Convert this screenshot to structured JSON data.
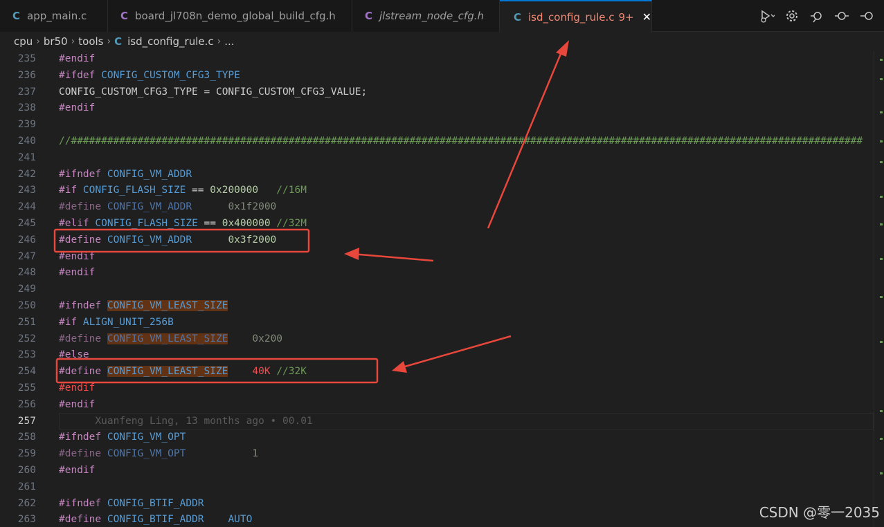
{
  "tabs": [
    {
      "label": "app_main.c",
      "kind": "c",
      "italic": false,
      "active": false
    },
    {
      "label": "board_jl708n_demo_global_build_cfg.h",
      "kind": "c",
      "italic": false,
      "active": false
    },
    {
      "label": "jlstream_node_cfg.h",
      "kind": "c",
      "italic": true,
      "active": false
    },
    {
      "label": "isd_config_rule.c",
      "kind": "c",
      "italic": false,
      "active": true,
      "badge": "9+"
    }
  ],
  "file_icon_glyph": "C",
  "close_glyph": "✕",
  "breadcrumb": [
    "cpu",
    "br50",
    "tools",
    "isd_config_rule.c",
    "..."
  ],
  "toolbar_icons": [
    "run-debug-icon",
    "chevron-down-icon",
    "settings-icon",
    "timeline-icon",
    "git-commit-icon",
    "more-icon"
  ],
  "lines": [
    {
      "n": "235",
      "parts": [
        [
          "k",
          "#endif"
        ]
      ]
    },
    {
      "n": "236",
      "parts": [
        [
          "k",
          "#ifdef "
        ],
        [
          "m",
          "CONFIG_CUSTOM_CFG3_TYPE"
        ]
      ]
    },
    {
      "n": "237",
      "parts": [
        [
          "t",
          "CONFIG_CUSTOM_CFG3_TYPE = CONFIG_CUSTOM_CFG3_VALUE;"
        ]
      ]
    },
    {
      "n": "238",
      "parts": [
        [
          "k",
          "#endif"
        ]
      ]
    },
    {
      "n": "239",
      "parts": []
    },
    {
      "n": "240",
      "parts": [
        [
          "c",
          "//###################################################################################################################################"
        ]
      ]
    },
    {
      "n": "241",
      "parts": []
    },
    {
      "n": "242",
      "parts": [
        [
          "k",
          "#ifndef "
        ],
        [
          "m",
          "CONFIG_VM_ADDR"
        ]
      ]
    },
    {
      "n": "243",
      "parts": [
        [
          "k",
          "#if "
        ],
        [
          "m",
          "CONFIG_FLASH_SIZE"
        ],
        [
          "t",
          " == "
        ],
        [
          "n",
          "0x200000"
        ],
        [
          "t",
          "   "
        ],
        [
          "c",
          "//16M"
        ]
      ]
    },
    {
      "n": "244",
      "parts": [
        [
          "kd",
          "#define "
        ],
        [
          "mi",
          "CONFIG_VM_ADDR"
        ],
        [
          "t",
          "      "
        ],
        [
          "nd",
          "0x1f2000"
        ]
      ]
    },
    {
      "n": "245",
      "parts": [
        [
          "k",
          "#elif "
        ],
        [
          "m",
          "CONFIG_FLASH_SIZE"
        ],
        [
          "t",
          " == "
        ],
        [
          "n",
          "0x400000"
        ],
        [
          "t",
          " "
        ],
        [
          "c",
          "//32M"
        ]
      ]
    },
    {
      "n": "246",
      "parts": [
        [
          "k",
          "#define "
        ],
        [
          "m",
          "CONFIG_VM_ADDR"
        ],
        [
          "t",
          "      "
        ],
        [
          "n",
          "0x3f2000"
        ]
      ]
    },
    {
      "n": "247",
      "parts": [
        [
          "k",
          "#endif"
        ]
      ]
    },
    {
      "n": "248",
      "parts": [
        [
          "k",
          "#endif"
        ]
      ]
    },
    {
      "n": "249",
      "parts": []
    },
    {
      "n": "250",
      "parts": [
        [
          "k",
          "#ifndef "
        ],
        [
          "m hl",
          "CONFIG_VM_LEAST_SIZE"
        ]
      ]
    },
    {
      "n": "251",
      "parts": [
        [
          "k",
          "#if "
        ],
        [
          "m",
          "ALIGN_UNIT_256B"
        ]
      ]
    },
    {
      "n": "252",
      "parts": [
        [
          "kd",
          "#define "
        ],
        [
          "mi hl",
          "CONFIG_VM_LEAST_SIZE"
        ],
        [
          "t",
          "    "
        ],
        [
          "nd",
          "0x200"
        ]
      ]
    },
    {
      "n": "253",
      "parts": [
        [
          "k",
          "#else"
        ]
      ]
    },
    {
      "n": "254",
      "parts": [
        [
          "k",
          "#define "
        ],
        [
          "m hl",
          "CONFIG_VM_LEAST_SIZE"
        ],
        [
          "t",
          "    "
        ],
        [
          "r",
          "40K"
        ],
        [
          "t",
          " "
        ],
        [
          "c",
          "//32K"
        ]
      ]
    },
    {
      "n": "255",
      "parts": [
        [
          "r",
          "#endif"
        ]
      ]
    },
    {
      "n": "256",
      "parts": [
        [
          "k",
          "#endif"
        ]
      ]
    },
    {
      "n": "257",
      "parts": [
        [
          "blame",
          "      Xuanfeng Ling, 13 months ago • 00.01"
        ]
      ],
      "current": true
    },
    {
      "n": "258",
      "parts": [
        [
          "k",
          "#ifndef "
        ],
        [
          "m",
          "CONFIG_VM_OPT"
        ]
      ]
    },
    {
      "n": "259",
      "parts": [
        [
          "kd",
          "#define "
        ],
        [
          "mi",
          "CONFIG_VM_OPT"
        ],
        [
          "t",
          "           "
        ],
        [
          "nd",
          "1"
        ]
      ]
    },
    {
      "n": "260",
      "parts": [
        [
          "k",
          "#endif"
        ]
      ]
    },
    {
      "n": "261",
      "parts": []
    },
    {
      "n": "262",
      "parts": [
        [
          "k",
          "#ifndef "
        ],
        [
          "m",
          "CONFIG_BTIF_ADDR"
        ]
      ]
    },
    {
      "n": "263",
      "parts": [
        [
          "k",
          "#define "
        ],
        [
          "m",
          "CONFIG_BTIF_ADDR"
        ],
        [
          "t",
          "    "
        ],
        [
          "m",
          "AUTO"
        ]
      ]
    }
  ],
  "annotation_color": "#e8473b",
  "watermark": "CSDN @零一2035"
}
